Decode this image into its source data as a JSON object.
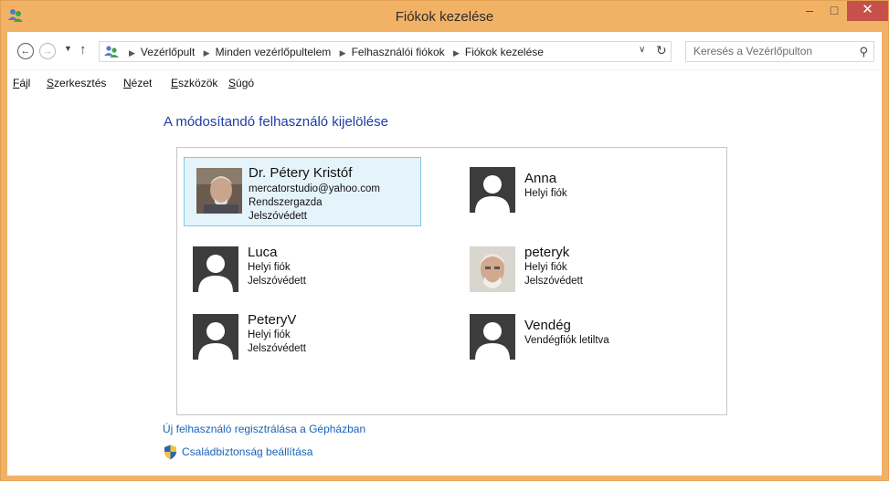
{
  "window": {
    "title": "Fiókok kezelése",
    "controls": {
      "minimize": "–",
      "maximize": "□",
      "close": "✕"
    },
    "accent": "#f2b266"
  },
  "nav": {
    "back_icon": "back-icon",
    "forward_icon": "forward-icon",
    "breadcrumbs": [
      "Vezérlőpult",
      "Minden vezérlőpultelem",
      "Felhasználói fiókok",
      "Fiókok kezelése"
    ],
    "search_placeholder": "Keresés a Vezérlőpulton"
  },
  "menu": [
    {
      "label": "Fájl",
      "key": "F",
      "rest": "ájl"
    },
    {
      "label": "Szerkesztés",
      "key": "S",
      "rest": "zerkesztés"
    },
    {
      "label": "Nézet",
      "key": "N",
      "rest": "ézet"
    },
    {
      "label": "Eszközök",
      "key": "E",
      "rest": "szközök"
    },
    {
      "label": "Súgó",
      "key": "S",
      "rest": "úgó"
    }
  ],
  "main": {
    "heading": "A módosítandó felhasználó kijelölése",
    "users": [
      {
        "name": "Dr. Pétery Kristóf",
        "lines": [
          "mercatorstudio@yahoo.com",
          "Rendszergazda",
          "Jelszóvédett"
        ],
        "avatar": "photo",
        "selected": true
      },
      {
        "name": "Anna",
        "lines": [
          "Helyi fiók"
        ],
        "avatar": "generic",
        "selected": false
      },
      {
        "name": "Luca",
        "lines": [
          "Helyi fiók",
          "Jelszóvédett"
        ],
        "avatar": "generic",
        "selected": false
      },
      {
        "name": "peteryk",
        "lines": [
          "Helyi fiók",
          "Jelszóvédett"
        ],
        "avatar": "photo2",
        "selected": false
      },
      {
        "name": "PeteryV",
        "lines": [
          "Helyi fiók",
          "Jelszóvédett"
        ],
        "avatar": "generic",
        "selected": false
      },
      {
        "name": "Vendég",
        "lines": [
          "Vendégfiók letiltva"
        ],
        "avatar": "generic",
        "selected": false
      }
    ],
    "links": {
      "new_user": "Új felhasználó regisztrálása a Gépházban",
      "family_safety": "Családbiztonság beállítása"
    }
  }
}
